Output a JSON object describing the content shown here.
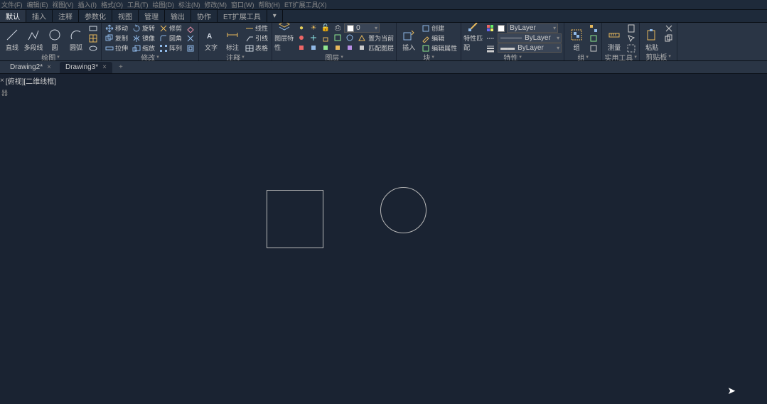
{
  "menubar": [
    "文件(F)",
    "编辑(E)",
    "视图(V)",
    "插入(I)",
    "格式(O)",
    "工具(T)",
    "绘图(D)",
    "标注(N)",
    "修改(M)",
    "窗口(W)",
    "帮助(H)",
    "ET扩展工具(X)"
  ],
  "ribbon_tabs": [
    "默认",
    "插入",
    "注释",
    "参数化",
    "视图",
    "管理",
    "输出",
    "协作",
    "ET扩展工具",
    "▾"
  ],
  "panels": {
    "draw": {
      "title": "绘图",
      "items": [
        "直线",
        "多段线",
        "圆",
        "圆弧"
      ]
    },
    "modify": {
      "title": "修改",
      "rows": [
        [
          "移动",
          "旋转",
          "修剪"
        ],
        [
          "复制",
          "镜像",
          "圆角"
        ],
        [
          "拉伸",
          "缩放",
          "阵列"
        ]
      ]
    },
    "annot": {
      "title": "注释",
      "items": [
        "文字",
        "标注"
      ],
      "side": [
        "线性",
        "引线",
        "表格"
      ]
    },
    "layer": {
      "title": "图层",
      "big": "图层特性",
      "combo_val": "0",
      "row1": [
        "light-on",
        "sun-icon",
        "lock-open",
        "print-icon",
        "swatch"
      ],
      "row2": [
        "layer-off",
        "freeze",
        "lock",
        "match",
        "diff",
        "set-current",
        "置为当前"
      ],
      "row3": [
        "iso",
        "uniso",
        "match2",
        "prev",
        "walk",
        "匹配图层"
      ]
    },
    "block": {
      "title": "块",
      "big": "插入",
      "side": [
        "创建",
        "编辑",
        "编辑属性"
      ]
    },
    "prop": {
      "title": "特性",
      "big": "特性匹配",
      "combo1": "ByLayer",
      "combo2": "ByLayer",
      "combo3": "ByLayer"
    },
    "group": {
      "title": "组",
      "big": "组"
    },
    "util": {
      "title": "实用工具",
      "items": [
        "测量"
      ]
    },
    "clip": {
      "title": "剪贴板",
      "big": "粘贴"
    }
  },
  "doctabs": [
    {
      "name": "Drawing2*",
      "active": false
    },
    {
      "name": "Drawing3*",
      "active": true
    }
  ],
  "viewport_label": "[俯视][二维线框]",
  "viewport_nav": "器"
}
